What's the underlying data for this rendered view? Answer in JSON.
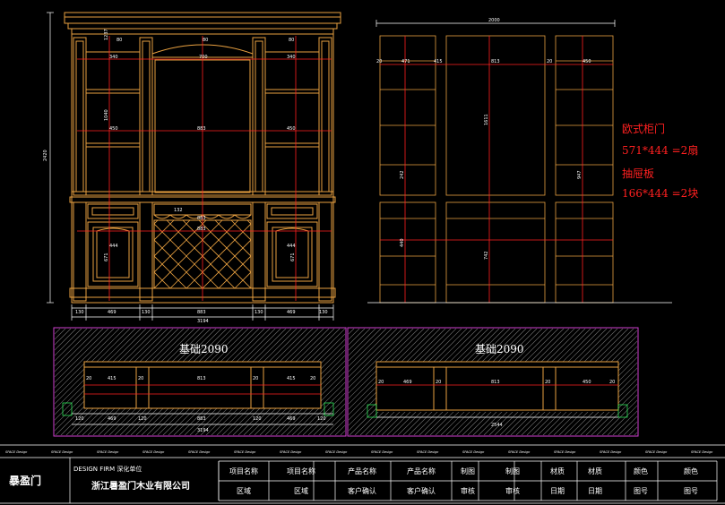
{
  "front_dims": {
    "bottom": [
      "130",
      "469",
      "130",
      "883",
      "130",
      "469",
      "130"
    ],
    "total": "3194",
    "height": "2420",
    "upper_inner": [
      "450",
      "883",
      "450"
    ],
    "upper_mid": [
      "700",
      "340",
      "340"
    ],
    "upper_marks": [
      "80",
      "80",
      "80"
    ],
    "lower_marks": [
      "444",
      "671",
      "883",
      "444",
      "671"
    ],
    "upper_side": [
      "1237",
      "1040"
    ],
    "wine_marks": [
      "132",
      "883"
    ]
  },
  "side_dims": {
    "top": "2000",
    "widths": [
      "471",
      "813",
      "450"
    ],
    "left_marks": [
      "20",
      "415",
      "20"
    ],
    "heights": [
      "1611",
      "947",
      "242",
      "440",
      "742"
    ]
  },
  "annotation": {
    "line1": "欧式柜门",
    "line2": "571*444 =2扇",
    "line3": "抽屉板",
    "line4": "166*444 =2块"
  },
  "base_left": {
    "title": "基础2090",
    "dims": [
      "120",
      "469",
      "120",
      "883",
      "120",
      "469",
      "120"
    ],
    "inner": [
      "20",
      "415",
      "20",
      "813",
      "20",
      "415",
      "20"
    ],
    "total": "3194"
  },
  "base_right": {
    "title": "基础2090",
    "dims": [
      "20",
      "469",
      "20",
      "813",
      "20",
      "450",
      "20"
    ],
    "total": "2544"
  },
  "strip_text": "SPACE Design",
  "title_block": {
    "logo": "暴盈门",
    "firm_label": "DESIGN FIRM 深化单位",
    "company": "浙江暑盈门木业有限公司",
    "row1": [
      "项目名称",
      "项目名称",
      "产品名称",
      "产品名称",
      "制图",
      "制图",
      "材质",
      "材质",
      "颜色",
      "颜色"
    ],
    "row2": [
      "区域",
      "区域",
      "客户确认",
      "客户确认",
      "审核",
      "审核",
      "日期",
      "日期",
      "图号",
      "图号"
    ]
  }
}
